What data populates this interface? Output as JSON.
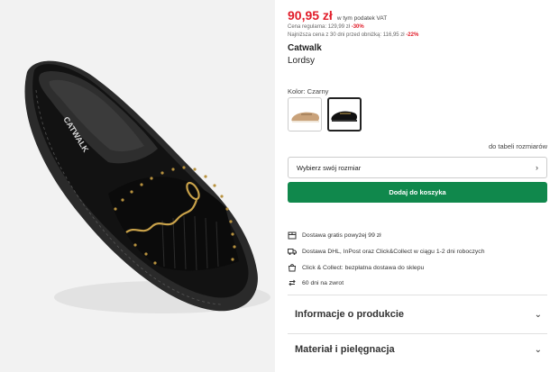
{
  "product": {
    "price": "90,95 zł",
    "vat_note": "w tym podatek VAT",
    "regular_label": "Cena regularna: 129,99 zł",
    "regular_discount": "-30%",
    "lowest_label": "Najniższa cena z 30 dni przed obniżką: 116,95 zł",
    "lowest_discount": "-22%",
    "brand": "Catwalk",
    "model": "Lordsy",
    "shoe_brand_print": "CATWALK"
  },
  "color": {
    "label": "Kolor: Czarny",
    "swatches": [
      {
        "name": "beige",
        "selected": false
      },
      {
        "name": "black",
        "selected": true
      }
    ]
  },
  "size": {
    "table_link": "do tabeli rozmiarów",
    "select_placeholder": "Wybierz swój rozmiar"
  },
  "cart": {
    "add_label": "Dodaj do koszyka",
    "accent": "#10884c"
  },
  "features": [
    {
      "icon": "package-icon",
      "text": "Dostawa gratis powyżej 99 zł"
    },
    {
      "icon": "truck-icon",
      "text": "Dostawa DHL, InPost oraz Click&Collect w ciągu 1-2 dni roboczych"
    },
    {
      "icon": "store-bag-icon",
      "text": "Click & Collect: bezpłatna dostawa do sklepu"
    },
    {
      "icon": "return-arrows-icon",
      "text": "60 dni na zwrot"
    }
  ],
  "accordions": [
    {
      "label": "Informacje o produkcie"
    },
    {
      "label": "Materiał i pielęgnacja"
    }
  ],
  "colors": {
    "price_red": "#e11d2a",
    "button_green": "#10884c"
  }
}
